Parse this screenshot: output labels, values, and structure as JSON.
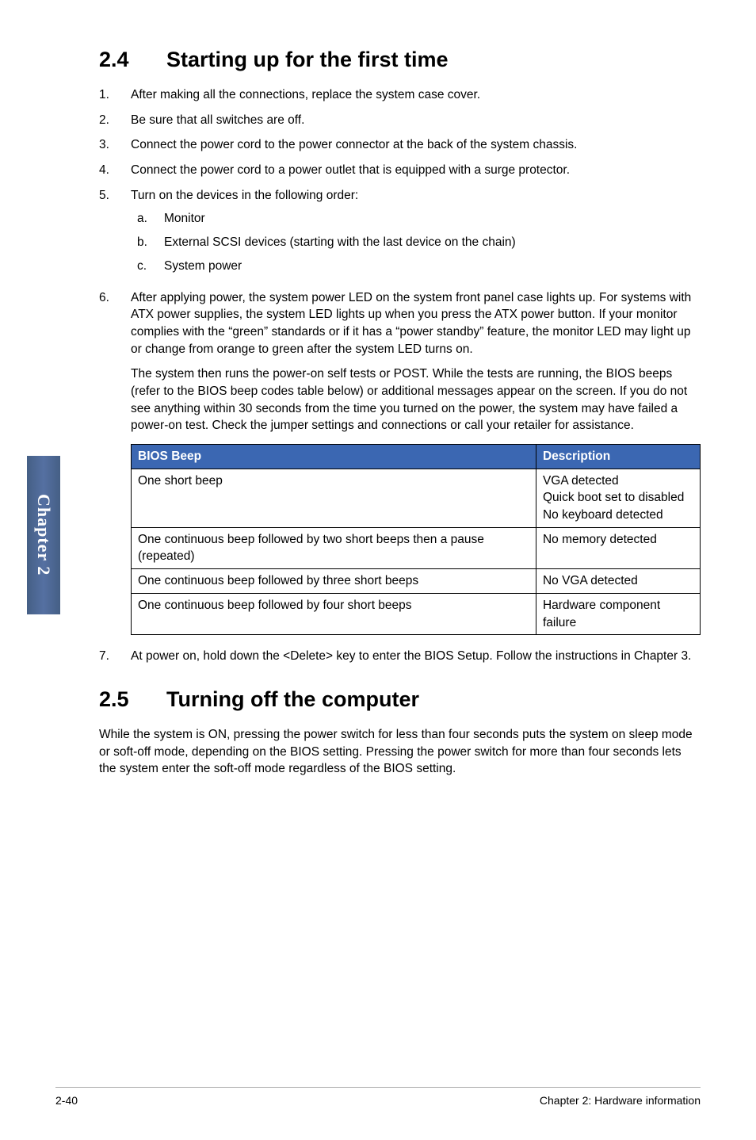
{
  "side_tab": "Chapter 2",
  "section_24": {
    "number": "2.4",
    "title": "Starting up for the first time"
  },
  "list_24": {
    "i1": {
      "n": "1.",
      "t": "After making all the connections, replace the system case cover."
    },
    "i2": {
      "n": "2.",
      "t": "Be sure that all switches are off."
    },
    "i3": {
      "n": "3.",
      "t": "Connect the power cord to the power connector at the back of the system chassis."
    },
    "i4": {
      "n": "4.",
      "t": "Connect the power cord to a power outlet that is equipped with a surge protector."
    },
    "i5": {
      "n": "5.",
      "t": "Turn on the devices in the following order:"
    },
    "i5a": {
      "n": "a.",
      "t": "Monitor"
    },
    "i5b": {
      "n": "b.",
      "t": "External SCSI devices (starting with the last device on the chain)"
    },
    "i5c": {
      "n": "c.",
      "t": "System power"
    },
    "i6": {
      "n": "6.",
      "t": "After applying power, the system power LED on the system front panel case lights up. For systems with ATX power supplies, the system LED lights up when you press the ATX power button. If your monitor complies with the “green” standards or if it has a “power standby” feature, the monitor LED may light up or change from orange to green after the system LED turns on."
    },
    "i6p2": "The system then runs the power-on self tests or POST. While the tests are running, the BIOS beeps (refer to the BIOS beep codes table below) or additional messages appear on the screen. If you do not see anything within 30 seconds from the time you turned on the power, the system may have failed a power-on test. Check the jumper settings and connections or call your retailer for assistance.",
    "i7": {
      "n": "7.",
      "t": "At power on, hold down the <Delete> key to enter the BIOS Setup. Follow the instructions in Chapter 3."
    }
  },
  "table": {
    "h1": "BIOS Beep",
    "h2": "Description",
    "r1c1": "One short beep",
    "r1c2": "VGA detected\nQuick boot set to disabled\nNo keyboard detected",
    "r2c1": "One continuous beep followed by two short beeps then a pause (repeated)",
    "r2c2": "No memory detected",
    "r3c1": "One continuous beep followed by three short beeps",
    "r3c2": "No VGA detected",
    "r4c1": "One continuous beep followed by four short beeps",
    "r4c2": "Hardware component failure"
  },
  "section_25": {
    "number": "2.5",
    "title": "Turning off the computer"
  },
  "para_25": "While the system is ON, pressing the power switch for less than four seconds puts the system on sleep mode or soft-off mode, depending on the BIOS setting. Pressing the power switch for more than four seconds lets the system enter the soft-off mode regardless of the BIOS setting.",
  "footer": {
    "page": "2-40",
    "chapter": "Chapter 2: Hardware information"
  }
}
